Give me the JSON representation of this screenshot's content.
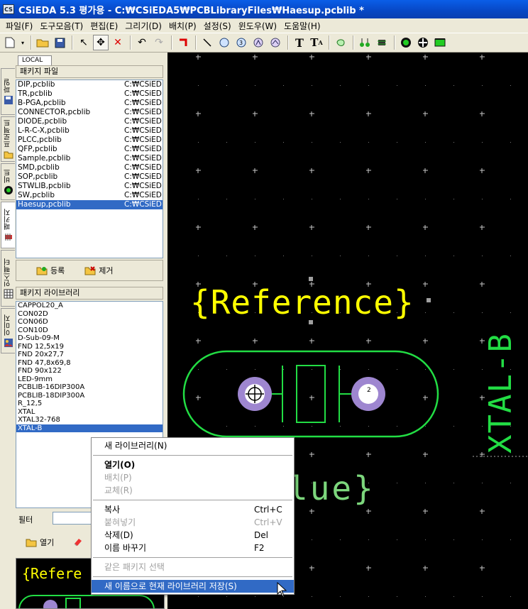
{
  "window": {
    "title": "CSiEDA 5.3 평가용 - C:₩CSiEDA5₩PCBLibraryFiles₩Haesup.pcblib *",
    "icon_text": "CS"
  },
  "menubar": [
    "파일(F)",
    "도구모음(T)",
    "편집(E)",
    "그리기(D)",
    "배치(P)",
    "설정(S)",
    "윈도우(W)",
    "도움말(H)"
  ],
  "side_tabs": [
    "파일",
    "프로젝트",
    "비트",
    "패키지",
    "인스펙터",
    "이미지"
  ],
  "panel": {
    "local_tab": "LOCAL",
    "package_files_header": "패키지 파일",
    "package_files": [
      {
        "name": "DIP,pcblib",
        "path": "C:₩CSiED"
      },
      {
        "name": "TR,pcblib",
        "path": "C:₩CSiED"
      },
      {
        "name": "B-PGA,pcblib",
        "path": "C:₩CSiED"
      },
      {
        "name": "CONNECTOR,pcblib",
        "path": "C:₩CSiED"
      },
      {
        "name": "DIODE,pcblib",
        "path": "C:₩CSiED"
      },
      {
        "name": "L-R-C-X,pcblib",
        "path": "C:₩CSiED"
      },
      {
        "name": "PLCC,pcblib",
        "path": "C:₩CSiED"
      },
      {
        "name": "QFP,pcblib",
        "path": "C:₩CSiED"
      },
      {
        "name": "Sample,pcblib",
        "path": "C:₩CSiED"
      },
      {
        "name": "SMD,pcblib",
        "path": "C:₩CSiED"
      },
      {
        "name": "SOP,pcblib",
        "path": "C:₩CSiED"
      },
      {
        "name": "STWLIB,pcblib",
        "path": "C:₩CSiED"
      },
      {
        "name": "SW,pcblib",
        "path": "C:₩CSiED"
      },
      {
        "name": "Haesup,pcblib",
        "path": "C:₩CSiED",
        "selected": true
      }
    ],
    "register_button": "등록",
    "remove_button": "제거",
    "package_library_header": "패키지 라이브러리",
    "package_library": [
      "CAPPOL20_A",
      "CON02D",
      "CON06D",
      "CON10D",
      "D-Sub-09-M",
      "FND 12,5x19",
      "FND 20x27,7",
      "FND 47,8x69,8",
      "FND 90x122",
      "LED-9mm",
      "PCBLIB-16DIP300A",
      "PCBLIB-18DIP300A",
      "R_12,5",
      "XTAL",
      "XTAL32-768",
      "XTAL-B"
    ],
    "package_library_selected": "XTAL-B",
    "filter_label": "필터",
    "open_button": "열기",
    "preview_text": "{Refere"
  },
  "canvas": {
    "reference_text": "{Reference}",
    "value_text": "lue}",
    "part_name": "XTAL-B",
    "pad_numbers": [
      "1",
      "2"
    ]
  },
  "context_menu": {
    "items": [
      {
        "label": "새 라이브러리(N)",
        "shortcut": "",
        "state": "normal"
      },
      {
        "sep": true
      },
      {
        "label": "열기(O)",
        "shortcut": "",
        "state": "bold"
      },
      {
        "label": "배치(P)",
        "shortcut": "",
        "state": "disabled"
      },
      {
        "label": "교체(R)",
        "shortcut": "",
        "state": "disabled"
      },
      {
        "sep": true
      },
      {
        "label": "복사",
        "shortcut": "Ctrl+C",
        "state": "normal"
      },
      {
        "label": "붙혀넣기",
        "shortcut": "Ctrl+V",
        "state": "disabled"
      },
      {
        "label": "삭제(D)",
        "shortcut": "Del",
        "state": "normal"
      },
      {
        "label": "이름 바꾸기",
        "shortcut": "F2",
        "state": "normal"
      },
      {
        "sep": true
      },
      {
        "label": "같은 패키지 선택",
        "shortcut": "",
        "state": "disabled"
      },
      {
        "sep": true
      },
      {
        "label": "새 이름으로 현재 라이브러리 저장(S)",
        "shortcut": "",
        "state": "highlighted"
      }
    ]
  },
  "colors": {
    "titlebar": "#0a5ee8",
    "canvas_bg": "#000000",
    "silkscreen_yellow": "#ffff00",
    "outline_green": "#22dd44",
    "pad_purple": "#9e86d0",
    "selection_blue": "#316ac5",
    "grid": "#c8c8c8"
  }
}
